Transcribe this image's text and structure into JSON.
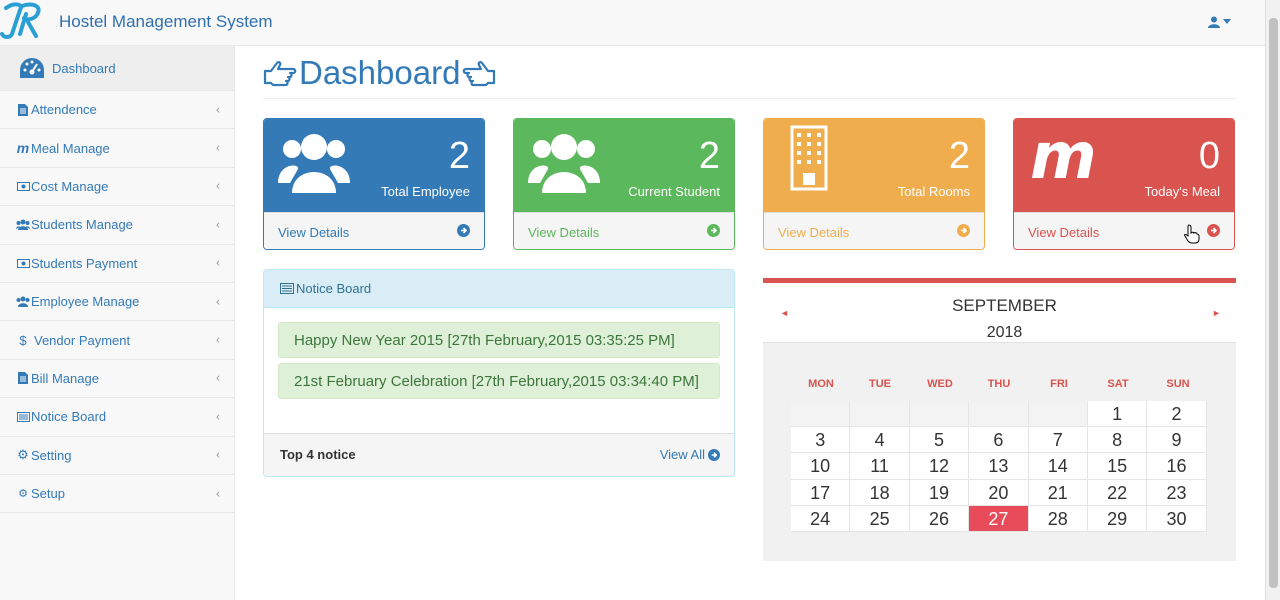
{
  "app": {
    "brand": "Hostel Management System"
  },
  "sidebar": {
    "items": [
      {
        "label": "Dashboard",
        "icon": "tachometer-icon"
      },
      {
        "label": "Attendence",
        "icon": "file-icon"
      },
      {
        "label": "Meal Manage",
        "icon": "meal-m-icon"
      },
      {
        "label": "Cost Manage",
        "icon": "money-icon"
      },
      {
        "label": "Students Manage",
        "icon": "users-icon"
      },
      {
        "label": "Students Payment",
        "icon": "money-icon"
      },
      {
        "label": "Employee Manage",
        "icon": "users-icon"
      },
      {
        "label": "Vendor Payment",
        "icon": "dollar-icon"
      },
      {
        "label": "Bill Manage",
        "icon": "file-icon"
      },
      {
        "label": "Notice Board",
        "icon": "list-icon"
      },
      {
        "label": "Setting",
        "icon": "gear-icon"
      },
      {
        "label": "Setup",
        "icon": "gears-icon"
      }
    ]
  },
  "page": {
    "title": "Dashboard"
  },
  "stats": [
    {
      "value": "2",
      "label": "Total Employee",
      "link": "View Details",
      "color": "#337ab7"
    },
    {
      "value": "2",
      "label": "Current Student",
      "link": "View Details",
      "color": "#5cb85c"
    },
    {
      "value": "2",
      "label": "Total Rooms",
      "link": "View Details",
      "color": "#f0ad4e"
    },
    {
      "value": "0",
      "label": "Today's Meal",
      "link": "View Details",
      "color": "#d9534f"
    }
  ],
  "notice": {
    "heading": "Notice Board",
    "items": [
      "Happy New Year 2015 [27th February,2015 03:35:25 PM]",
      "21st February Celebration [27th February,2015 03:34:40 PM]"
    ],
    "footer_label": "Top 4 notice",
    "view_all": "View All"
  },
  "calendar": {
    "month": "SEPTEMBER",
    "year": "2018",
    "weekdays": [
      "MON",
      "TUE",
      "WED",
      "THU",
      "FRI",
      "SAT",
      "SUN"
    ],
    "today": "27",
    "accent": "#e84c5a"
  }
}
